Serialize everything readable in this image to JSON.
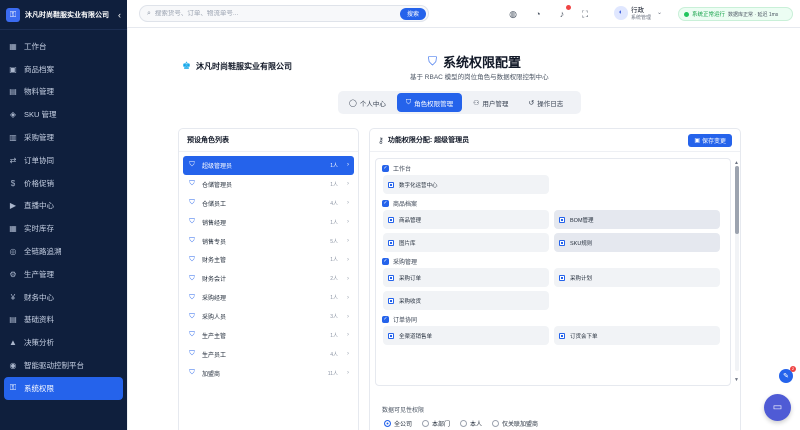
{
  "sidebar": {
    "company": "沐凡时尚鞋服实业有限公司",
    "collapse_icon": "chevron-left-icon",
    "items": [
      {
        "label": "工作台",
        "icon": "▦"
      },
      {
        "label": "商品档案",
        "icon": "▣"
      },
      {
        "label": "物料管理",
        "icon": "▤"
      },
      {
        "label": "SKU 管理",
        "icon": "◈"
      },
      {
        "label": "采购管理",
        "icon": "▥"
      },
      {
        "label": "订单协同",
        "icon": "⇄"
      },
      {
        "label": "价格促销",
        "icon": "$"
      },
      {
        "label": "直播中心",
        "icon": "▶"
      },
      {
        "label": "实时库存",
        "icon": "▦"
      },
      {
        "label": "全链路追溯",
        "icon": "◎"
      },
      {
        "label": "生产管理",
        "icon": "⚙"
      },
      {
        "label": "财务中心",
        "icon": "¥"
      },
      {
        "label": "基础资料",
        "icon": "▤"
      },
      {
        "label": "决策分析",
        "icon": "▲"
      },
      {
        "label": "智能驱动控制平台",
        "icon": "◉"
      },
      {
        "label": "系统权限",
        "icon": "⚿"
      }
    ]
  },
  "topbar": {
    "search_placeholder": "搜索货号、订单、物流单号...",
    "search_button": "搜索",
    "user_name": "行政",
    "user_role": "系统管理",
    "user_avatar": "◐",
    "status_text": "系统正常运行",
    "status_sub": "数据库正常 · 延迟 1ms"
  },
  "page": {
    "company": "沐凡时尚鞋服实业有限公司",
    "title": "系统权限配置",
    "subtitle": "基于 RBAC 模型的岗位角色与数据权限控制中心",
    "tabs": [
      {
        "label": "个人中心",
        "icon": "◯"
      },
      {
        "label": "角色权限管理",
        "icon": "⛉"
      },
      {
        "label": "用户管理",
        "icon": "⚇"
      },
      {
        "label": "操作日志",
        "icon": "↺"
      }
    ]
  },
  "roles": {
    "title": "预设角色列表",
    "items": [
      {
        "name": "超级管理员",
        "count": "1人"
      },
      {
        "name": "仓储管理员",
        "count": "1人"
      },
      {
        "name": "仓储员工",
        "count": "4人"
      },
      {
        "name": "销售经理",
        "count": "1人"
      },
      {
        "name": "销售专员",
        "count": "5人"
      },
      {
        "name": "财务主管",
        "count": "1人"
      },
      {
        "name": "财务会计",
        "count": "2人"
      },
      {
        "name": "采购经理",
        "count": "1人"
      },
      {
        "name": "采购人员",
        "count": "3人"
      },
      {
        "name": "生产主管",
        "count": "1人"
      },
      {
        "name": "生产员工",
        "count": "4人"
      },
      {
        "name": "加盟商",
        "count": "11人"
      }
    ]
  },
  "permissions": {
    "title": "功能权限分配: 超级管理员",
    "save_label": "保存变更",
    "groups": [
      {
        "title": "工作台",
        "items": [
          "数字化运营中心"
        ]
      },
      {
        "title": "商品档案",
        "items": [
          "商品管理",
          "BOM管理",
          "图片库",
          "SKU规则"
        ]
      },
      {
        "title": "采购管理",
        "items": [
          "采购订单",
          "采购计划",
          "采购收货"
        ]
      },
      {
        "title": "订单协同",
        "items": [
          "全渠道销售单",
          "订货会下单"
        ]
      }
    ],
    "visibility_label": "数据可见性权限",
    "visibility_options": [
      "全公司",
      "本部门",
      "本人",
      "仅关联加盟商"
    ]
  },
  "float": {
    "badge_count": "2"
  }
}
